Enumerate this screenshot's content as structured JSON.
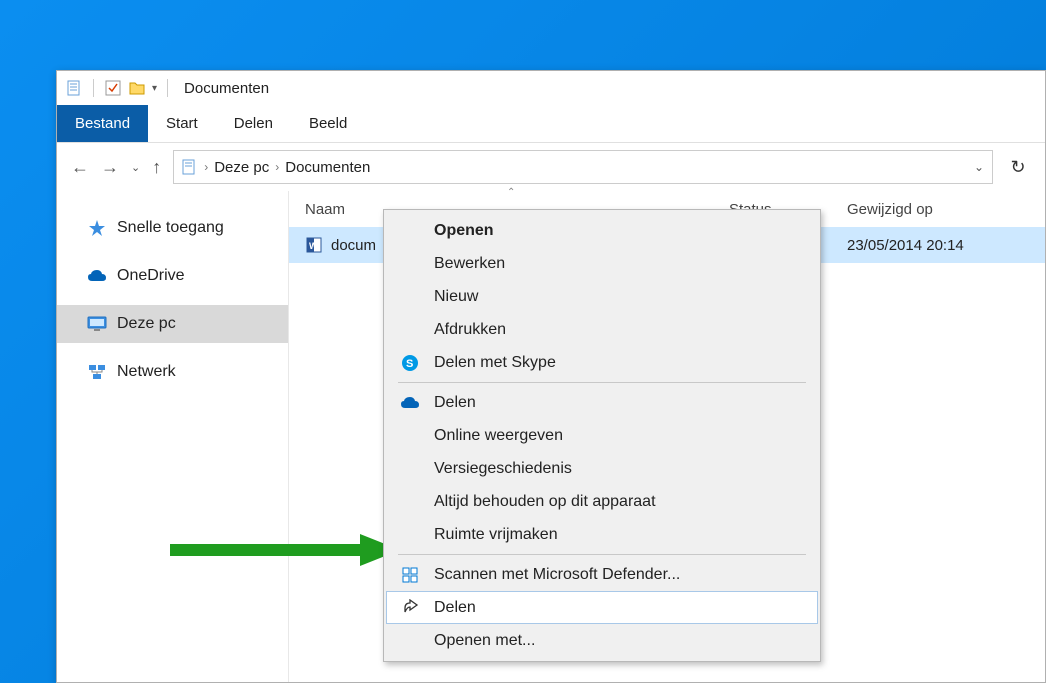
{
  "titlebar": {
    "title": "Documenten"
  },
  "menubar": {
    "bestand": "Bestand",
    "start": "Start",
    "delen": "Delen",
    "beeld": "Beeld"
  },
  "breadcrumb": {
    "root": "Deze pc",
    "folder": "Documenten"
  },
  "sidebar": {
    "quick": "Snelle toegang",
    "onedrive": "OneDrive",
    "thispc": "Deze pc",
    "network": "Netwerk"
  },
  "columns": {
    "name": "Naam",
    "status": "Status",
    "modified": "Gewijzigd op"
  },
  "file": {
    "name": "docum",
    "modified": "23/05/2014 20:14"
  },
  "context": {
    "open": "Openen",
    "edit": "Bewerken",
    "new": "Nieuw",
    "print": "Afdrukken",
    "skype": "Delen met Skype",
    "share_cloud": "Delen",
    "viewonline": "Online weergeven",
    "history": "Versiegeschiedenis",
    "keepdevice": "Altijd behouden op dit apparaat",
    "freespace": "Ruimte vrijmaken",
    "defender": "Scannen met Microsoft Defender...",
    "share": "Delen",
    "openwith": "Openen met..."
  }
}
